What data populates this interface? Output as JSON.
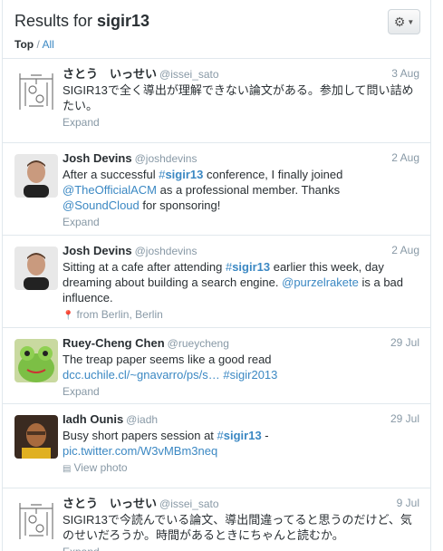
{
  "header": {
    "title_prefix": "Results for ",
    "query": "sigir13",
    "filter_top": "Top",
    "filter_sep": " / ",
    "filter_all": "All"
  },
  "tweets": [
    {
      "name": "さとう　いっせい",
      "handle": "@issei_sato",
      "date": "3 Aug",
      "segments": [
        {
          "t": "SIGIR13で全く導出が理解できない論文がある。参加して問い詰めたい。"
        }
      ],
      "meta": "Expand",
      "meta_icon": ""
    },
    {
      "name": "Josh Devins",
      "handle": "@joshdevins",
      "date": "2 Aug",
      "segments": [
        {
          "t": "After a successful "
        },
        {
          "t": "#",
          "type": "tag"
        },
        {
          "t": "sigir13",
          "type": "tagb"
        },
        {
          "t": " conference, I finally joined "
        },
        {
          "t": "@TheOfficialACM",
          "type": "link"
        },
        {
          "t": " as a professional member. Thanks "
        },
        {
          "t": "@SoundCloud",
          "type": "link"
        },
        {
          "t": " for sponsoring!"
        }
      ],
      "meta": "Expand",
      "meta_icon": ""
    },
    {
      "name": "Josh Devins",
      "handle": "@joshdevins",
      "date": "2 Aug",
      "segments": [
        {
          "t": "Sitting at a cafe after attending "
        },
        {
          "t": "#",
          "type": "tag"
        },
        {
          "t": "sigir13",
          "type": "tagb"
        },
        {
          "t": " earlier this week, day dreaming about building a search engine. "
        },
        {
          "t": "@purzelrakete",
          "type": "link"
        },
        {
          "t": " is a bad influence."
        }
      ],
      "meta": "from Berlin, Berlin",
      "meta_icon": "📍"
    },
    {
      "name": "Ruey-Cheng Chen",
      "handle": "@rueycheng",
      "date": "29 Jul",
      "segments": [
        {
          "t": "The treap paper seems like a good read "
        },
        {
          "t": "dcc.uchile.cl/~gnavarro/ps/s…",
          "type": "link"
        },
        {
          "t": " "
        },
        {
          "t": "#sigir2013",
          "type": "link"
        }
      ],
      "meta": "Expand",
      "meta_icon": ""
    },
    {
      "name": "Iadh Ounis",
      "handle": "@iadh",
      "date": "29 Jul",
      "segments": [
        {
          "t": "Busy short papers session at "
        },
        {
          "t": "#",
          "type": "tag"
        },
        {
          "t": "sigir13",
          "type": "tagb"
        },
        {
          "t": " - "
        },
        {
          "t": "pic.twitter.com/W3vMBm3neq",
          "type": "link"
        }
      ],
      "meta": "View photo",
      "meta_icon": "▤"
    },
    {
      "name": "さとう　いっせい",
      "handle": "@issei_sato",
      "date": "9 Jul",
      "segments": [
        {
          "t": "SIGIR13で今読んでいる論文、導出間違ってると思うのだけど、気のせいだろうか。時間があるときにちゃんと読むか。"
        }
      ],
      "meta": "Expand",
      "meta_icon": ""
    }
  ]
}
